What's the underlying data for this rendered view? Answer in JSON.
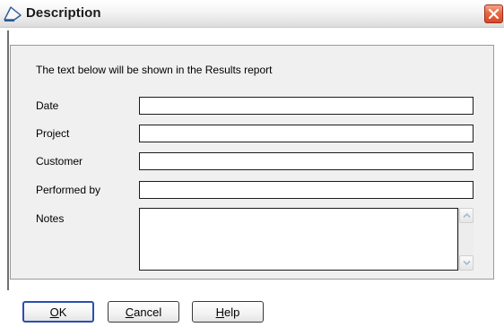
{
  "window": {
    "title": "Description",
    "title_icon": "description-document-icon",
    "close_icon": "close-icon"
  },
  "form": {
    "intro": "The text below will be shown in the Results report",
    "fields": [
      {
        "key": "date",
        "label": "Date",
        "value": ""
      },
      {
        "key": "project",
        "label": "Project",
        "value": ""
      },
      {
        "key": "customer",
        "label": "Customer",
        "value": ""
      },
      {
        "key": "performed_by",
        "label": "Performed by",
        "value": ""
      }
    ],
    "notes": {
      "label": "Notes",
      "value": ""
    }
  },
  "buttons": {
    "ok": {
      "mnemonic": "O",
      "rest": "K"
    },
    "cancel": {
      "mnemonic": "C",
      "rest": "ancel"
    },
    "help": {
      "mnemonic": "H",
      "rest": "elp"
    }
  },
  "colors": {
    "title_text": "#1a1a1a",
    "close_button": "#e8683f",
    "default_button_border": "#2b4fb0",
    "panel_background": "#f0f0f0"
  }
}
